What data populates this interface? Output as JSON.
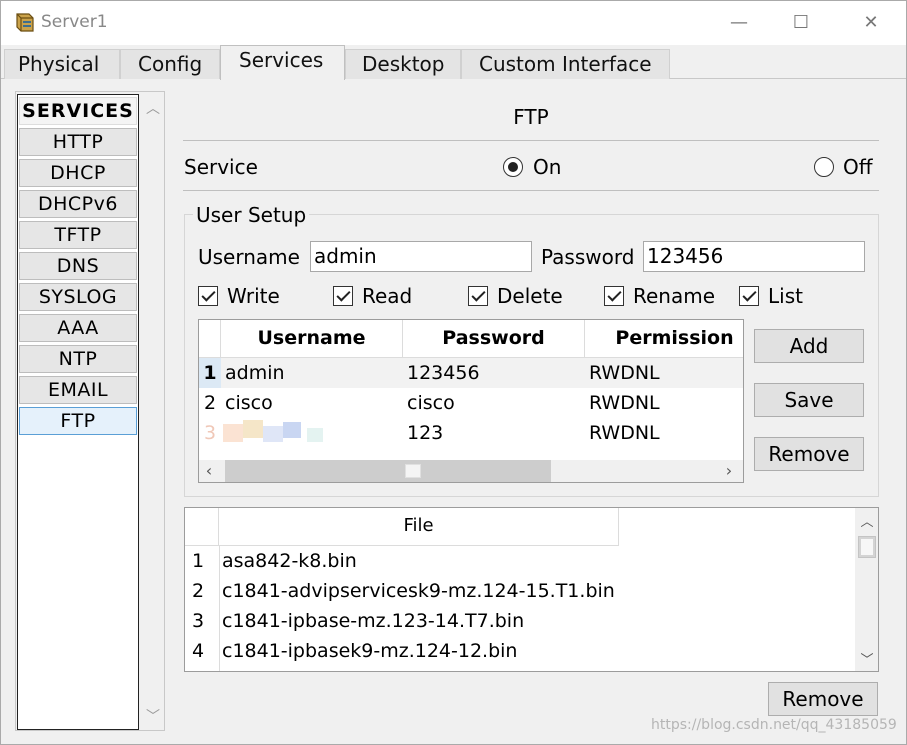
{
  "window": {
    "title": "Server1",
    "controls": {
      "minimize": "—",
      "maximize": "☐",
      "close": "✕"
    }
  },
  "tabs": [
    {
      "label": "Physical",
      "active": false
    },
    {
      "label": "Config",
      "active": false
    },
    {
      "label": "Services",
      "active": true
    },
    {
      "label": "Desktop",
      "active": false
    },
    {
      "label": "Custom Interface",
      "active": false
    }
  ],
  "services_list": {
    "header": "SERVICES",
    "items": [
      "HTTP",
      "DHCP",
      "DHCPv6",
      "TFTP",
      "DNS",
      "SYSLOG",
      "AAA",
      "NTP",
      "EMAIL",
      "FTP"
    ],
    "selected": "FTP"
  },
  "ftp": {
    "title": "FTP",
    "service_label": "Service",
    "on_label": "On",
    "off_label": "Off",
    "service_state": "On",
    "user_setup": {
      "title": "User Setup",
      "username_label": "Username",
      "username_value": "admin",
      "password_label": "Password",
      "password_value": "123456",
      "permissions": [
        {
          "label": "Write",
          "checked": true
        },
        {
          "label": "Read",
          "checked": true
        },
        {
          "label": "Delete",
          "checked": true
        },
        {
          "label": "Rename",
          "checked": true
        },
        {
          "label": "List",
          "checked": true
        }
      ],
      "table": {
        "columns": [
          "Username",
          "Password",
          "Permission"
        ],
        "rows": [
          {
            "num": "1",
            "username": "admin",
            "password": "123456",
            "permission": "RWDNL"
          },
          {
            "num": "2",
            "username": "cisco",
            "password": "cisco",
            "permission": "RWDNL"
          },
          {
            "num": "3",
            "username": "",
            "password": "123",
            "permission": "RWDNL"
          }
        ]
      },
      "buttons": {
        "add": "Add",
        "save": "Save",
        "remove": "Remove"
      }
    },
    "files": {
      "column": "File",
      "rows": [
        {
          "num": "1",
          "name": "asa842-k8.bin"
        },
        {
          "num": "2",
          "name": "c1841-advipservicesk9-mz.124-15.T1.bin"
        },
        {
          "num": "3",
          "name": "c1841-ipbase-mz.123-14.T7.bin"
        },
        {
          "num": "4",
          "name": "c1841-ipbasek9-mz.124-12.bin"
        }
      ],
      "remove_button": "Remove"
    }
  },
  "watermark": "https://blog.csdn.net/qq_43185059",
  "colors": {
    "selected_item_bg": "#e5f1fb",
    "selected_item_border": "#5a9fd6",
    "window_bg": "#f0f0f0"
  },
  "icons": {
    "app": "packet-tracer-server-icon",
    "scroll_up": "chevron-up-icon",
    "scroll_down": "chevron-down-icon",
    "scroll_left": "chevron-left-icon",
    "scroll_right": "chevron-right-icon"
  }
}
